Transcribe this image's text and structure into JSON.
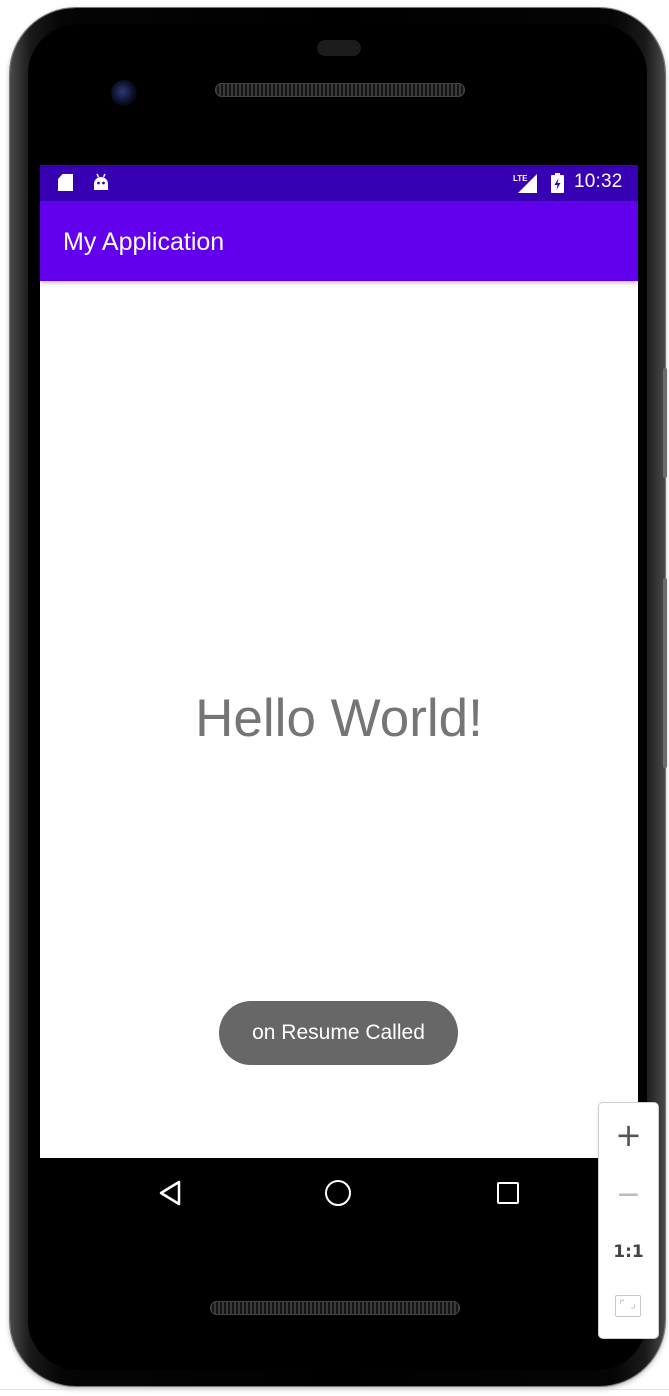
{
  "status_bar": {
    "time": "10:32",
    "network": "LTE",
    "icons": [
      "sd-card-icon",
      "android-debug-icon",
      "lte-signal-icon",
      "battery-charging-icon"
    ]
  },
  "app_bar": {
    "title": "My Application"
  },
  "content": {
    "message": "Hello World!"
  },
  "toast": {
    "text": "on Resume Called"
  },
  "nav_bar": {
    "icons": [
      "back-icon",
      "home-icon",
      "recents-icon"
    ]
  },
  "zoom_controls": {
    "zoom_in": "+",
    "zoom_out": "−",
    "reset": "1:1",
    "fit_icon": "fit-screen-icon"
  },
  "colors": {
    "status_bar": "#3700b3",
    "app_bar": "#6200ee",
    "toast": "#676767",
    "hello_text": "#757575"
  }
}
